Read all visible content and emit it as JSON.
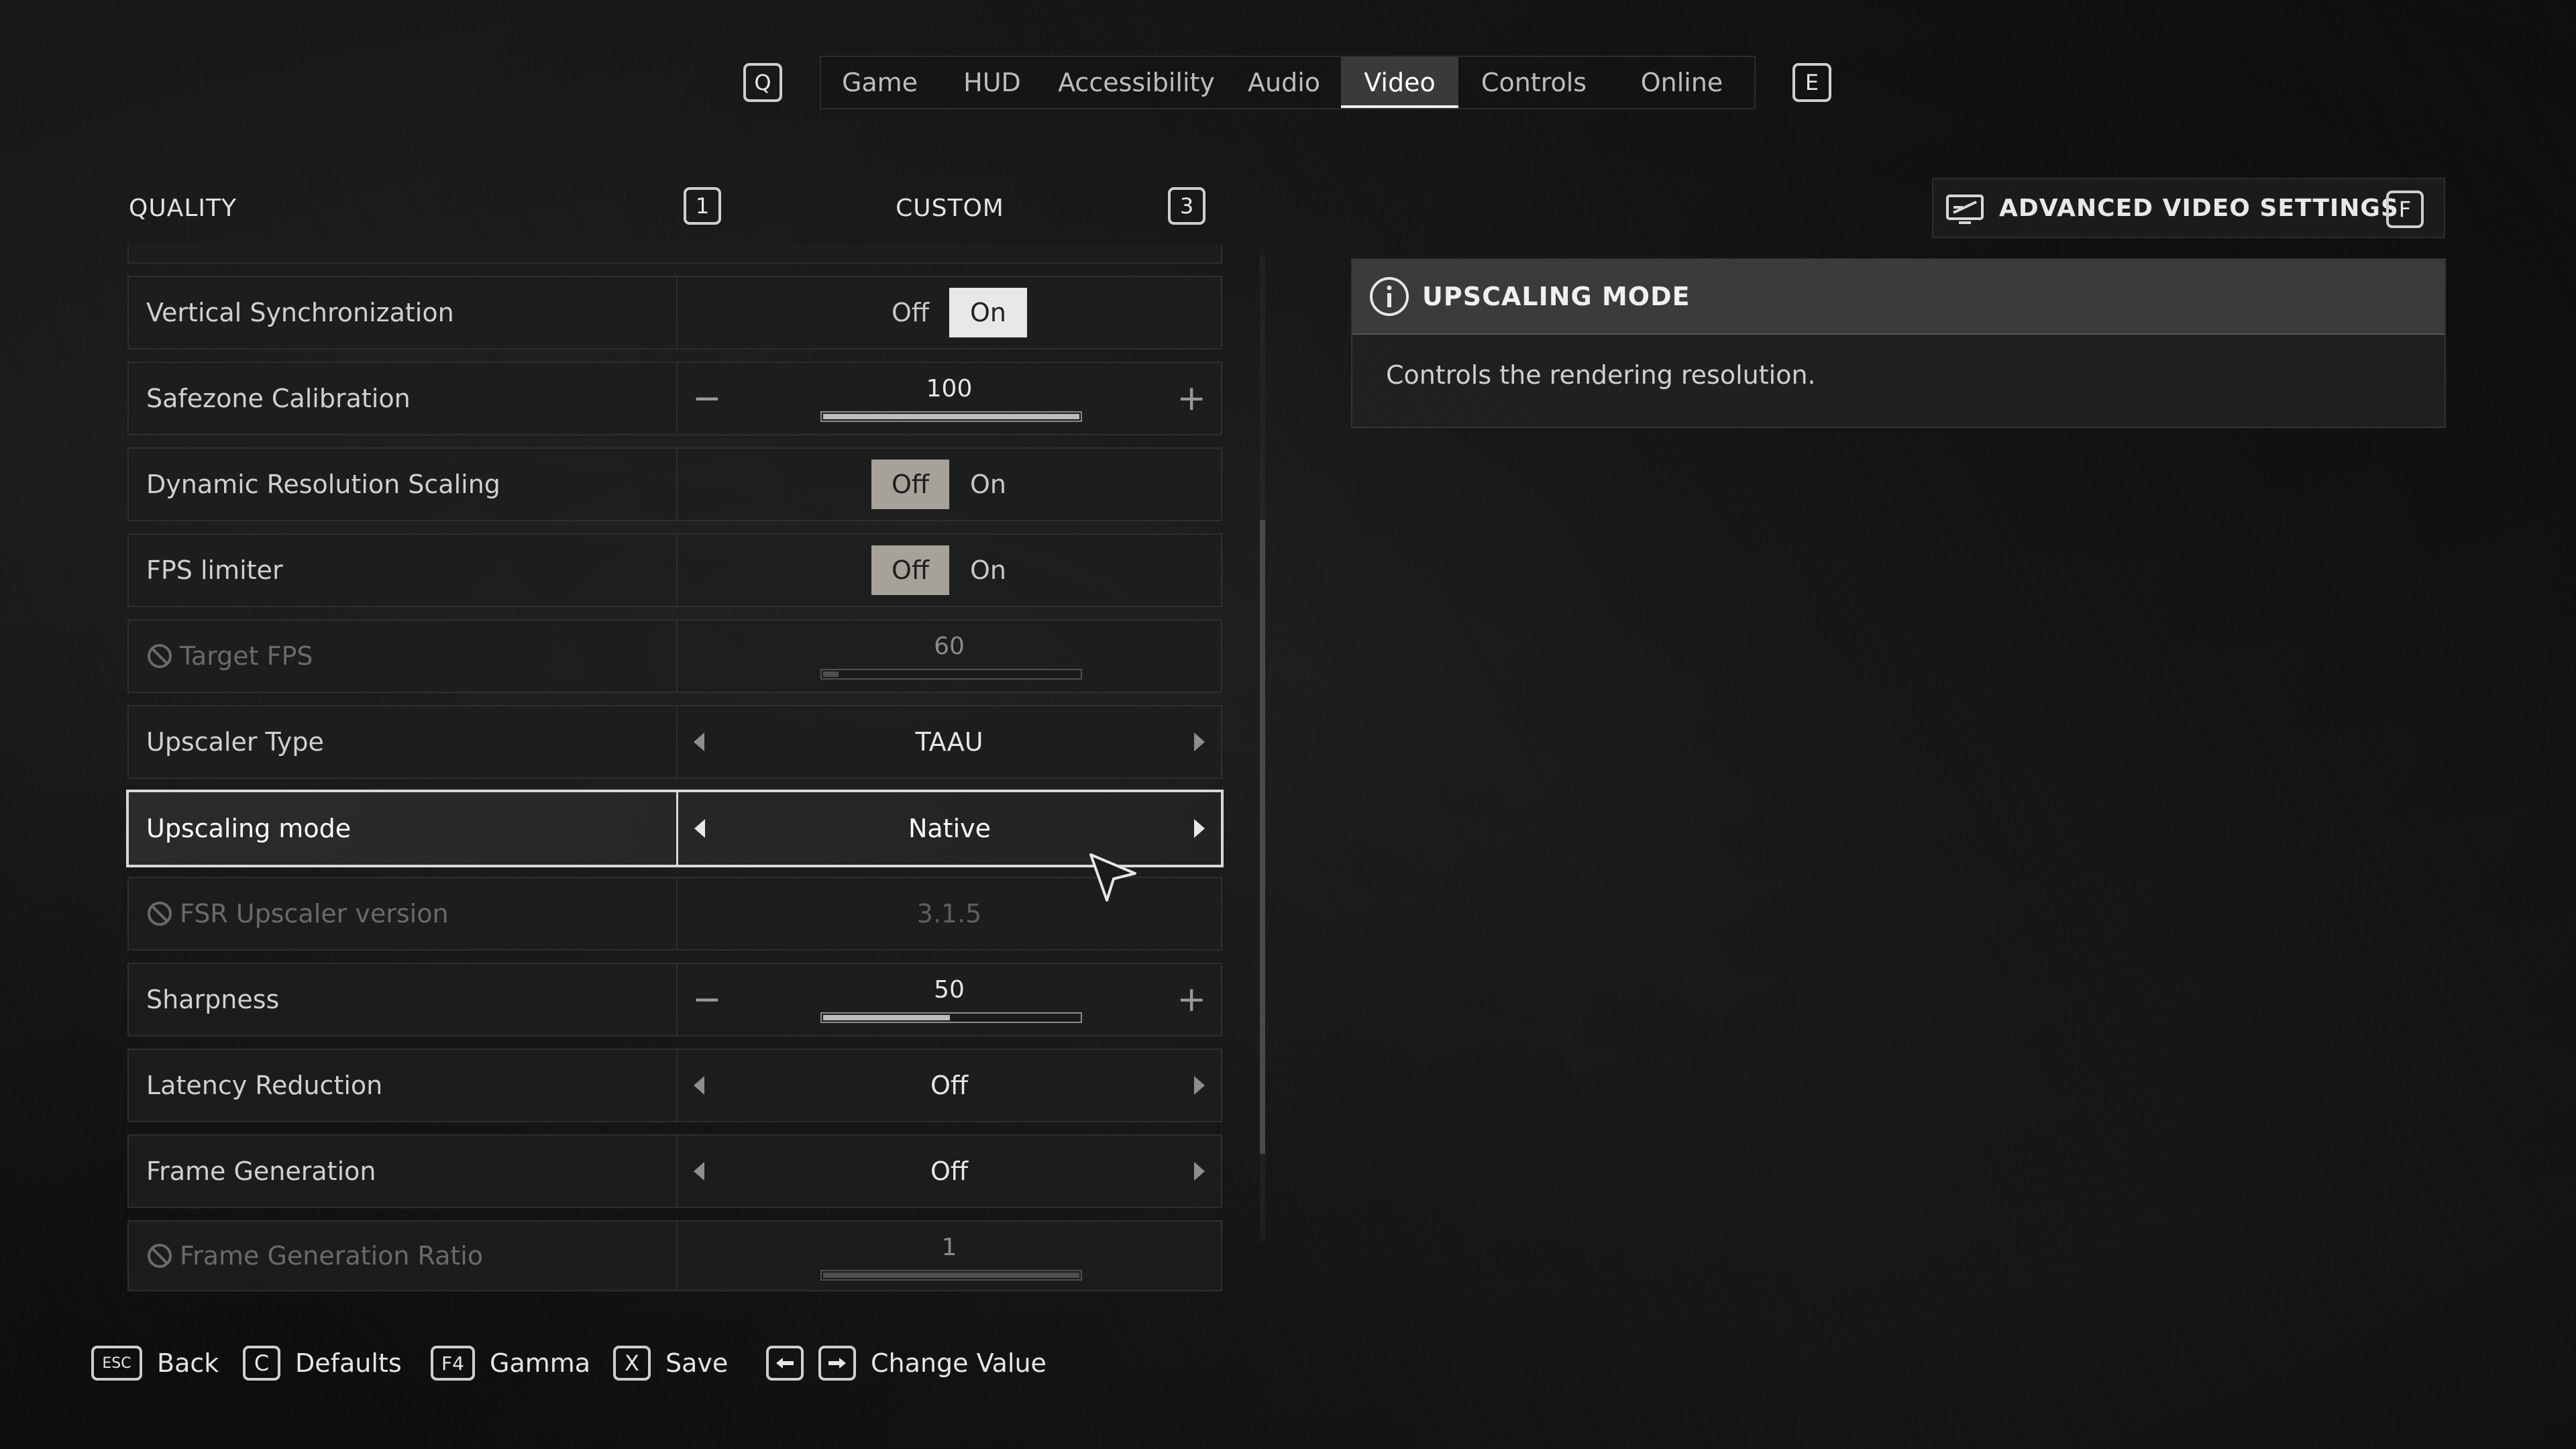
{
  "nav": {
    "prev_key": "Q",
    "next_key": "E",
    "tabs": [
      "Game",
      "HUD",
      "Accessibility",
      "Audio",
      "Video",
      "Controls",
      "Online"
    ],
    "active_tab": "Video"
  },
  "quality": {
    "label": "QUALITY",
    "prev_key": "1",
    "value": "CUSTOM",
    "next_key": "3"
  },
  "settings": {
    "vsync": {
      "label": "Vertical Synchronization",
      "off": "Off",
      "on": "On",
      "selected": "On"
    },
    "safezone": {
      "label": "Safezone Calibration",
      "value": "100",
      "fraction": 1.0
    },
    "drs": {
      "label": "Dynamic Resolution Scaling",
      "off": "Off",
      "on": "On",
      "selected": "Off"
    },
    "fps_limiter": {
      "label": "FPS limiter",
      "off": "Off",
      "on": "On",
      "selected": "Off"
    },
    "target_fps": {
      "label": "Target FPS",
      "value": "60",
      "fraction": 0.07,
      "disabled": true
    },
    "upscaler_type": {
      "label": "Upscaler Type",
      "value": "TAAU"
    },
    "upscaling_mode": {
      "label": "Upscaling mode",
      "value": "Native",
      "selected": true
    },
    "fsr_version": {
      "label": "FSR Upscaler version",
      "value": "3.1.5",
      "disabled": true
    },
    "sharpness": {
      "label": "Sharpness",
      "value": "50",
      "fraction": 0.5
    },
    "latency": {
      "label": "Latency Reduction",
      "value": "Off"
    },
    "frame_gen": {
      "label": "Frame Generation",
      "value": "Off"
    },
    "frame_gen_ratio": {
      "label": "Frame Generation Ratio",
      "value": "1",
      "fraction": 1.0,
      "disabled": true
    }
  },
  "advanced": {
    "label": "ADVANCED VIDEO SETTINGS",
    "key": "F"
  },
  "info": {
    "title": "UPSCALING MODE",
    "text": "Controls the rendering resolution."
  },
  "footer": {
    "back_key": "ESC",
    "back": "Back",
    "defaults_key": "C",
    "defaults": "Defaults",
    "gamma_key": "F4",
    "gamma": "Gamma",
    "save_key": "X",
    "save": "Save",
    "change": "Change Value"
  },
  "colors": {
    "active_tab_bg": "#3a3a3a",
    "toggle_on": "#e8e8e8",
    "toggle_off_selected": "#a6a29a"
  }
}
